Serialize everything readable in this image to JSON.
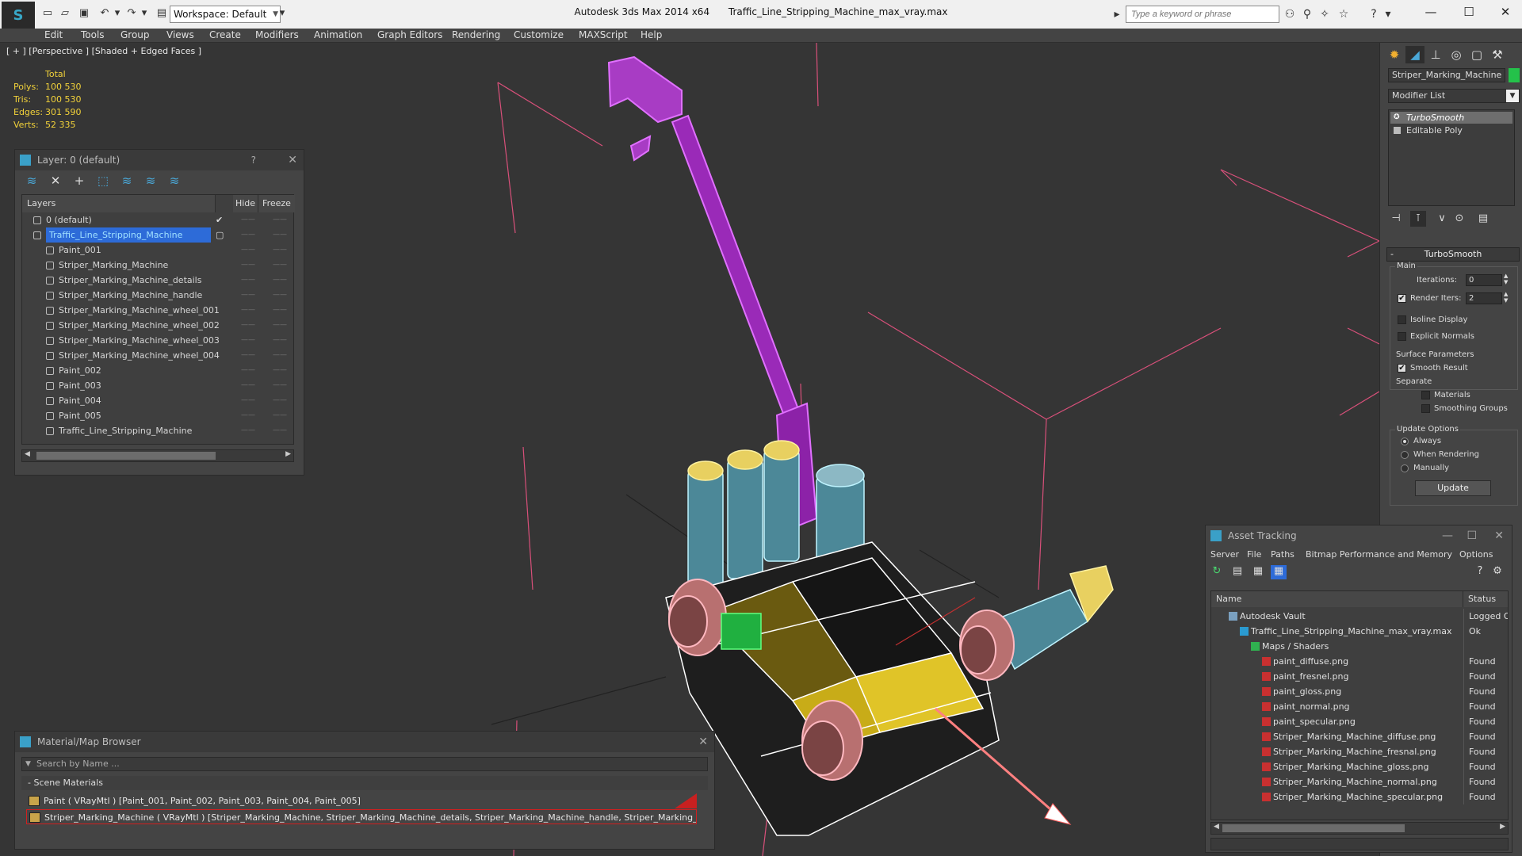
{
  "window": {
    "app_name": "Autodesk 3ds Max  2014 x64",
    "file_name": "Traffic_Line_Stripping_Machine_max_vray.max",
    "workspace": "Workspace: Default",
    "search_placeholder": "Type a keyword or phrase"
  },
  "menu": [
    "Edit",
    "Tools",
    "Group",
    "Views",
    "Create",
    "Modifiers",
    "Animation",
    "Graph Editors",
    "Rendering",
    "Customize",
    "MAXScript",
    "Help"
  ],
  "viewport": {
    "label": "[ + ] [Perspective ] [Shaded + Edged Faces ]",
    "stats": {
      "total_label": "Total",
      "rows": [
        {
          "key": "Polys:",
          "value": "100 530"
        },
        {
          "key": "Tris:",
          "value": "100 530"
        },
        {
          "key": "Edges:",
          "value": "301 590"
        },
        {
          "key": "Verts:",
          "value": "52 335"
        }
      ]
    }
  },
  "layer_panel": {
    "title": "Layer: 0 (default)",
    "help": "?",
    "columns": {
      "layers": "Layers",
      "hide": "Hide",
      "freeze": "Freeze"
    },
    "rows": [
      {
        "name": "0 (default)",
        "indent": 0,
        "checked": true
      },
      {
        "name": "Traffic_Line_Stripping_Machine",
        "indent": 0,
        "selected": true
      },
      {
        "name": "Paint_001",
        "indent": 1
      },
      {
        "name": "Striper_Marking_Machine",
        "indent": 1
      },
      {
        "name": "Striper_Marking_Machine_details",
        "indent": 1
      },
      {
        "name": "Striper_Marking_Machine_handle",
        "indent": 1
      },
      {
        "name": "Striper_Marking_Machine_wheel_001",
        "indent": 1
      },
      {
        "name": "Striper_Marking_Machine_wheel_002",
        "indent": 1
      },
      {
        "name": "Striper_Marking_Machine_wheel_003",
        "indent": 1
      },
      {
        "name": "Striper_Marking_Machine_wheel_004",
        "indent": 1
      },
      {
        "name": "Paint_002",
        "indent": 1
      },
      {
        "name": "Paint_003",
        "indent": 1
      },
      {
        "name": "Paint_004",
        "indent": 1
      },
      {
        "name": "Paint_005",
        "indent": 1
      },
      {
        "name": "Traffic_Line_Stripping_Machine",
        "indent": 1
      }
    ]
  },
  "material_browser": {
    "title": "Material/Map Browser",
    "search_placeholder": "Search by Name ...",
    "section": "Scene Materials",
    "rows": [
      "Paint  ( VRayMtl )  [Paint_001, Paint_002, Paint_003, Paint_004, Paint_005]",
      "Striper_Marking_Machine  ( VRayMtl )  [Striper_Marking_Machine, Striper_Marking_Machine_details, Striper_Marking_Machine_handle, Striper_Marking_Machine_..."
    ]
  },
  "command_panel": {
    "object_name": "Striper_Marking_Machine",
    "object_color": "#24c24a",
    "modifier_list": "Modifier List",
    "stack": [
      "TurboSmooth",
      "Editable Poly"
    ],
    "rollout_title": "TurboSmooth",
    "main": {
      "label": "Main",
      "iterations_label": "Iterations:",
      "iterations_value": "0",
      "render_iters_label": "Render Iters:",
      "render_iters_value": "2",
      "isoline_label": "Isoline Display",
      "explicit_label": "Explicit Normals"
    },
    "surface": {
      "label": "Surface Parameters",
      "smooth_result": "Smooth Result",
      "separate": "Separate",
      "materials": "Materials",
      "smoothing_groups": "Smoothing Groups"
    },
    "update": {
      "label": "Update Options",
      "always": "Always",
      "when_rendering": "When Rendering",
      "manually": "Manually",
      "button": "Update"
    }
  },
  "asset_tracking": {
    "title": "Asset Tracking",
    "menu": [
      "Server",
      "File",
      "Paths",
      "Bitmap Performance and Memory",
      "Options"
    ],
    "columns": {
      "name": "Name",
      "status": "Status"
    },
    "rows": [
      {
        "name": "Autodesk Vault",
        "status": "Logged O",
        "indent": 1,
        "icon": "vault"
      },
      {
        "name": "Traffic_Line_Stripping_Machine_max_vray.max",
        "status": "Ok",
        "indent": 2,
        "icon": "max"
      },
      {
        "name": "Maps / Shaders",
        "status": "",
        "indent": 3,
        "icon": "maps"
      },
      {
        "name": "paint_diffuse.png",
        "status": "Found",
        "indent": 4,
        "icon": "png"
      },
      {
        "name": "paint_fresnel.png",
        "status": "Found",
        "indent": 4,
        "icon": "png"
      },
      {
        "name": "paint_gloss.png",
        "status": "Found",
        "indent": 4,
        "icon": "png"
      },
      {
        "name": "paint_normal.png",
        "status": "Found",
        "indent": 4,
        "icon": "png"
      },
      {
        "name": "paint_specular.png",
        "status": "Found",
        "indent": 4,
        "icon": "png"
      },
      {
        "name": "Striper_Marking_Machine_diffuse.png",
        "status": "Found",
        "indent": 4,
        "icon": "png"
      },
      {
        "name": "Striper_Marking_Machine_fresnal.png",
        "status": "Found",
        "indent": 4,
        "icon": "png"
      },
      {
        "name": "Striper_Marking_Machine_gloss.png",
        "status": "Found",
        "indent": 4,
        "icon": "png"
      },
      {
        "name": "Striper_Marking_Machine_normal.png",
        "status": "Found",
        "indent": 4,
        "icon": "png"
      },
      {
        "name": "Striper_Marking_Machine_specular.png",
        "status": "Found",
        "indent": 4,
        "icon": "png"
      }
    ]
  }
}
